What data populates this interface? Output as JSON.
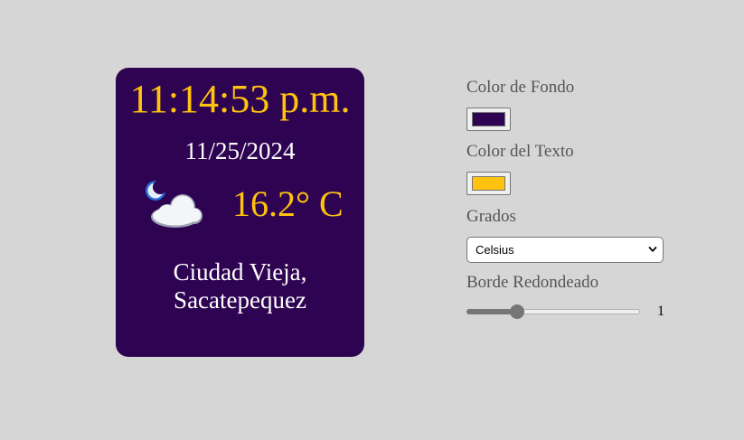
{
  "widget": {
    "time": "11:14:53 p.m.",
    "date": "11/25/2024",
    "weather_icon": "night-cloudy-icon",
    "temperature": "16.2° C",
    "location_line1": "Ciudad Vieja,",
    "location_line2": "Sacatepequez"
  },
  "settings": {
    "background_color_label": "Color de Fondo",
    "background_color_value": "#2e0452",
    "text_color_label": "Color del Texto",
    "text_color_value": "#ffc20e",
    "degrees_label": "Grados",
    "degrees_selected": "Celsius",
    "rounded_border_label": "Borde Redondeado",
    "rounded_border_value": "1",
    "rounded_border_level": 0.27
  },
  "colors": {
    "page_background": "#d6d6d6",
    "card_background": "#2e0452",
    "accent_text": "#ffc20e",
    "secondary_text": "#ffffff",
    "label_text": "#555555"
  }
}
